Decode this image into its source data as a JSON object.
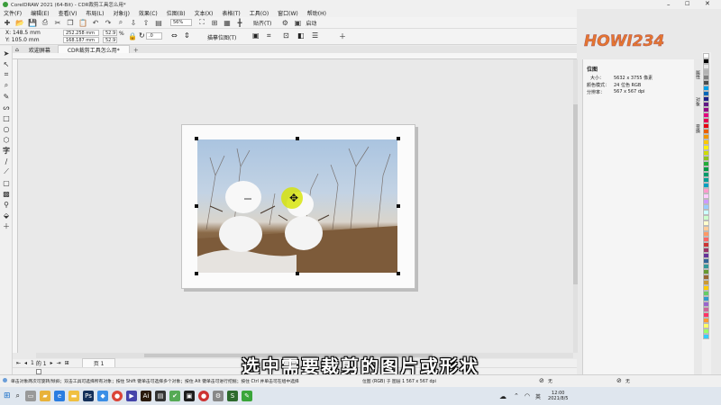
{
  "window": {
    "title": "CorelDRAW 2021 (64-Bit) - CDR裁剪工具怎么用*"
  },
  "menu": [
    "文件(F)",
    "编辑(E)",
    "查看(V)",
    "布局(L)",
    "对象(J)",
    "效果(C)",
    "位图(B)",
    "文本(X)",
    "表格(T)",
    "工具(O)",
    "窗口(W)",
    "帮助(H)"
  ],
  "toolbar": {
    "zoom": "56%",
    "snap_label": "贴齐(T)",
    "launch_label": "启动"
  },
  "propbar": {
    "x": "X: 148.5 mm",
    "y": "Y: 105.0 mm",
    "w": "252.258 mm",
    "h": "168.187 mm",
    "sx": "52.9",
    "sy": "52.9",
    "pct": "%",
    "angle": ".0",
    "trace": "描摹位图(T)"
  },
  "tabs": [
    "欢迎屏幕",
    "CDR裁剪工具怎么用*"
  ],
  "docker": {
    "title": "位图",
    "size_label": "大小：",
    "size_value": "5632 x 3755 像素",
    "mode_label": "颜色模式：",
    "mode_value": "24 位色 RGB",
    "res_label": "分辨率：",
    "res_value": "567 x 567 dpi",
    "side_tabs": [
      "属性",
      "对象",
      "变换"
    ]
  },
  "logo": "HOWI234",
  "caption": "选中需要裁剪的图片或形状",
  "page_nav": {
    "current": "1",
    "of": "的 1",
    "page_tab": "页 1"
  },
  "status": {
    "left": "单击对象两次可旋转/倾斜；双击工具可选择所有对象；按住 Shift 键单击可选择多个对象；按住 Alt 键单击可进行挖掘；按住 Ctrl 并单击可在组中选择",
    "mid": "位图 (RGB) 于 图层 1 567 x 567 dpi",
    "fill_none": "无",
    "outline_none": "无"
  },
  "taskbar": {
    "time": "12:00",
    "date": "2021/8/5",
    "lang": "英"
  },
  "palette_colors": [
    "#ffffff",
    "#000000",
    "#e6e6e6",
    "#b3b3b3",
    "#808080",
    "#4d4d4d",
    "#00a0e9",
    "#0068b7",
    "#1d2088",
    "#601986",
    "#920783",
    "#e4007f",
    "#e5004f",
    "#e60012",
    "#eb6100",
    "#f39800",
    "#fcc800",
    "#fff100",
    "#cfdb00",
    "#8fc31f",
    "#22ac38",
    "#009944",
    "#009b6b",
    "#009e96",
    "#00a0c1",
    "#ff99cc",
    "#ffccff",
    "#cc99ff",
    "#99ccff",
    "#ccffff",
    "#ccffcc",
    "#ffffcc",
    "#ffcc99",
    "#ff9966",
    "#ff6666",
    "#cc3333",
    "#993366",
    "#663399",
    "#336699",
    "#339999",
    "#669933",
    "#996633",
    "#cc9933",
    "#ffcc00",
    "#66cc66",
    "#3399cc",
    "#9966cc",
    "#cc6699",
    "#ff3366",
    "#ff9933",
    "#ffff66",
    "#99ff66",
    "#33ccff"
  ]
}
